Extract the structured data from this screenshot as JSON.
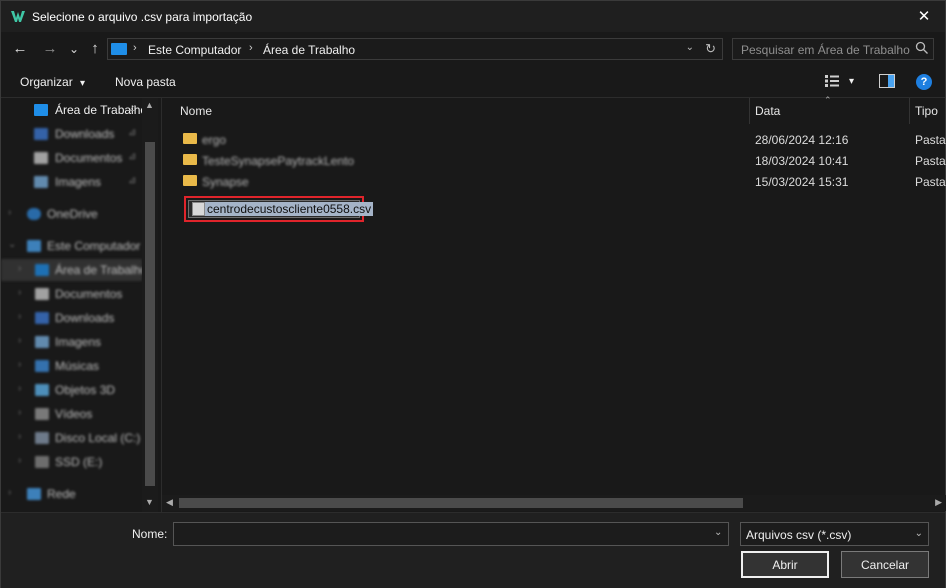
{
  "window": {
    "title": "Selecione o arquivo .csv para importação",
    "close_glyph": "✕"
  },
  "nav": {
    "back_glyph": "←",
    "forward_glyph": "→",
    "recent_glyph": "⌄",
    "up_glyph": "↑"
  },
  "address": {
    "crumbs": [
      "Este Computador",
      "Área de Trabalho"
    ],
    "separator": "›",
    "dropdown_glyph": "⌄",
    "refresh_glyph": "↻"
  },
  "search": {
    "placeholder": "Pesquisar em Área de Trabalho"
  },
  "command_bar": {
    "organize_label": "Organizar",
    "organize_arrow": "▾",
    "new_folder_label": "Nova pasta",
    "view_arrow": "▾",
    "help_glyph": "?"
  },
  "sidebar": {
    "items": [
      {
        "label": "Área de Trabalho",
        "icon": "desktop-icon",
        "pinned": true
      },
      {
        "label": "Downloads",
        "icon": "download-icon",
        "pinned": true
      },
      {
        "label": "Documentos",
        "icon": "documents-icon",
        "pinned": true
      },
      {
        "label": "Imagens",
        "icon": "pictures-icon",
        "pinned": true
      },
      {
        "label": "OneDrive",
        "icon": "cloud-icon"
      },
      {
        "label": "Este Computador",
        "icon": "computer-icon"
      },
      {
        "label": "Área de Trabalho",
        "icon": "desktop-icon",
        "selected": true
      },
      {
        "label": "Documentos",
        "icon": "documents-icon"
      },
      {
        "label": "Downloads",
        "icon": "download-icon"
      },
      {
        "label": "Imagens",
        "icon": "pictures-icon"
      },
      {
        "label": "Músicas",
        "icon": "music-icon"
      },
      {
        "label": "Objetos 3D",
        "icon": "cube-icon"
      },
      {
        "label": "Vídeos",
        "icon": "video-icon"
      },
      {
        "label": "Disco Local (C:)",
        "icon": "drive-icon"
      },
      {
        "label": "SSD (E:)",
        "icon": "drive-icon"
      },
      {
        "label": "Rede",
        "icon": "network-icon"
      }
    ],
    "pin_glyph": "📌",
    "expand_glyph": "›",
    "collapse_glyph": "⌄",
    "scroll_up": "▲",
    "scroll_down": "▼"
  },
  "filelist": {
    "columns": {
      "name": "Nome",
      "date": "Data",
      "type": "Tipo"
    },
    "sort_glyph": "⌃",
    "rows": [
      {
        "name": "ergo",
        "date": "28/06/2024 12:16",
        "type": "Pasta"
      },
      {
        "name": "TesteSynapsePaytrackLento",
        "date": "18/03/2024 10:41",
        "type": "Pasta"
      },
      {
        "name": "Synapse",
        "date": "15/03/2024 15:31",
        "type": "Pasta"
      }
    ],
    "selected_file": "centrodecustoscliente0558.csv",
    "hscroll_left": "◀",
    "hscroll_right": "▶"
  },
  "footer": {
    "name_label": "Nome:",
    "name_value": "",
    "name_dropdown_glyph": "⌄",
    "filter_value": "Arquivos csv (*.csv)",
    "filter_dropdown_glyph": "⌄",
    "open_label": "Abrir",
    "cancel_label": "Cancelar"
  },
  "colors": {
    "accent": "#1e7fe0",
    "folder": "#e9b949",
    "highlight_border": "#e0242b",
    "selection_fill": "#a5b4c8"
  }
}
